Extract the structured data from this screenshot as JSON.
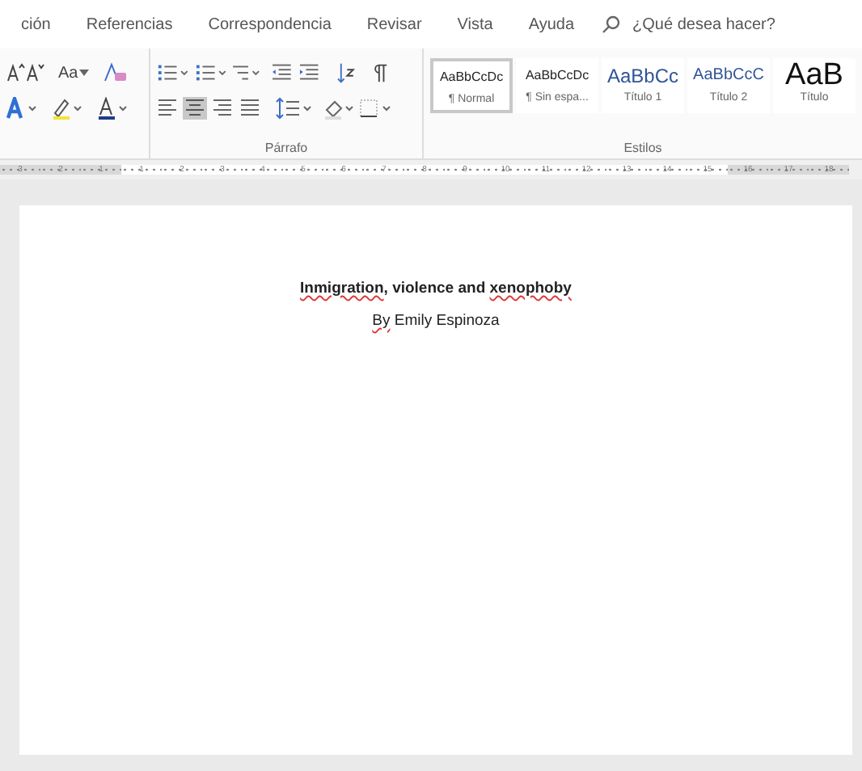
{
  "menu_tabs": [
    {
      "label": "ción",
      "selected": false
    },
    {
      "label": "Referencias",
      "selected": false
    },
    {
      "label": "Correspondencia",
      "selected": false
    },
    {
      "label": "Revisar",
      "selected": false
    },
    {
      "label": "Vista",
      "selected": false
    },
    {
      "label": "Ayuda",
      "selected": false
    }
  ],
  "search": {
    "placeholder": "¿Qué desea hacer?"
  },
  "font_group": {
    "case_button": "Aa"
  },
  "paragraph_group": {
    "label": "Párrafo",
    "centered_selected": true
  },
  "styles_group": {
    "label": "Estilos",
    "styles": [
      {
        "preview": "AaBbCcDc",
        "name": "¶ Normal",
        "kind": "normal",
        "selected": true
      },
      {
        "preview": "AaBbCcDc",
        "name": "¶ Sin espa...",
        "kind": "normal",
        "selected": false
      },
      {
        "preview": "AaBbCc",
        "name": "Título 1",
        "kind": "heading1",
        "selected": false
      },
      {
        "preview": "AaBbCcC",
        "name": "Título 2",
        "kind": "heading2",
        "selected": false
      },
      {
        "preview": "AaB",
        "name": "Título",
        "kind": "title",
        "selected": false
      }
    ]
  },
  "ruler": {
    "left_labels": [
      "3",
      "2",
      "1"
    ],
    "labels": [
      "1",
      "2",
      "3",
      "4",
      "5",
      "6",
      "7",
      "8",
      "9",
      "10",
      "11",
      "12",
      "13",
      "14",
      "15"
    ],
    "right_labels": [
      "16",
      "17",
      "18"
    ]
  },
  "document": {
    "title": [
      {
        "text": "Inmigration",
        "misspelled": true
      },
      {
        "text": ", ",
        "misspelled": false
      },
      {
        "text": "violence",
        "misspelled": false
      },
      {
        "text": " and ",
        "misspelled": false
      },
      {
        "text": "xenophoby",
        "misspelled": true
      }
    ],
    "byline": [
      {
        "text": "By",
        "misspelled": true
      },
      {
        "text": " Emily Espinoza",
        "misspelled": false
      }
    ]
  }
}
